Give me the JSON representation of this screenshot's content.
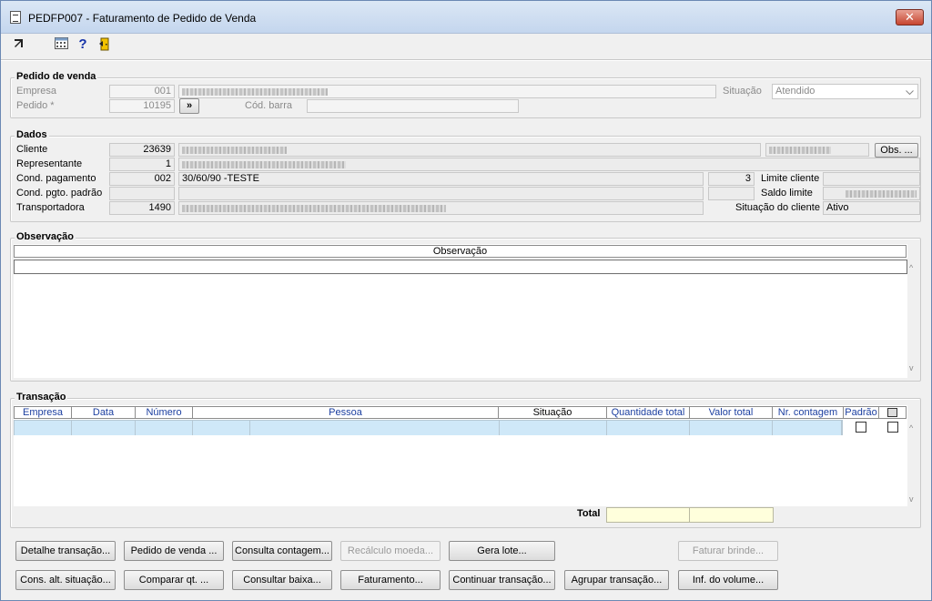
{
  "window": {
    "title": "PEDFP007 - Faturamento de Pedido de Venda",
    "close_label": "✕"
  },
  "toolbar": {
    "icons": [
      "arrow-icon",
      "calendar-icon",
      "help-icon",
      "exit-icon"
    ],
    "help_glyph": "?"
  },
  "pedido": {
    "title": "Pedido de venda",
    "empresa_label": "Empresa",
    "empresa_code": "001",
    "pedido_label": "Pedido *",
    "pedido_value": "10195",
    "pedido_btn": "»",
    "codbarra_label": "Cód. barra",
    "situacao_label": "Situação",
    "situacao_value": "Atendido"
  },
  "dados": {
    "title": "Dados",
    "cliente_label": "Cliente",
    "cliente_code": "23639",
    "obs_btn": "Obs. ...",
    "representante_label": "Representante",
    "representante_code": "1",
    "cond_pag_label": "Cond. pagamento",
    "cond_pag_code": "002",
    "cond_pag_desc": "30/60/90 -TESTE",
    "cond_pag_num": "3",
    "limite_label": "Limite cliente",
    "cond_padrao_label": "Cond. pgto. padrão",
    "saldo_label": "Saldo limite",
    "transp_label": "Transportadora",
    "transp_code": "1490",
    "sit_cliente_label": "Situação do cliente",
    "sit_cliente_value": "Ativo"
  },
  "observacao": {
    "title": "Observação",
    "column": "Observação"
  },
  "transacao": {
    "title": "Transação",
    "columns": [
      "Empresa",
      "Data",
      "Número",
      "Pessoa",
      "Situação",
      "Quantidade total",
      "Valor total",
      "Nr. contagem",
      "Padrão"
    ],
    "total_label": "Total"
  },
  "buttons": {
    "row1": [
      "Detalhe transação...",
      "Pedido de venda ...",
      "Consulta contagem...",
      "Recálculo moeda...",
      "Gera lote...",
      "Faturar brinde..."
    ],
    "row2": [
      "Cons. alt. situação...",
      "Comparar qt. ...",
      "Consultar baixa...",
      "Faturamento...",
      "Continuar transação...",
      "Agrupar transação...",
      "Inf. do volume..."
    ]
  },
  "colors": {
    "accent_blue": "#1b3fa0",
    "selected_row": "#cfe8f8",
    "total_field": "#ffffdc"
  }
}
